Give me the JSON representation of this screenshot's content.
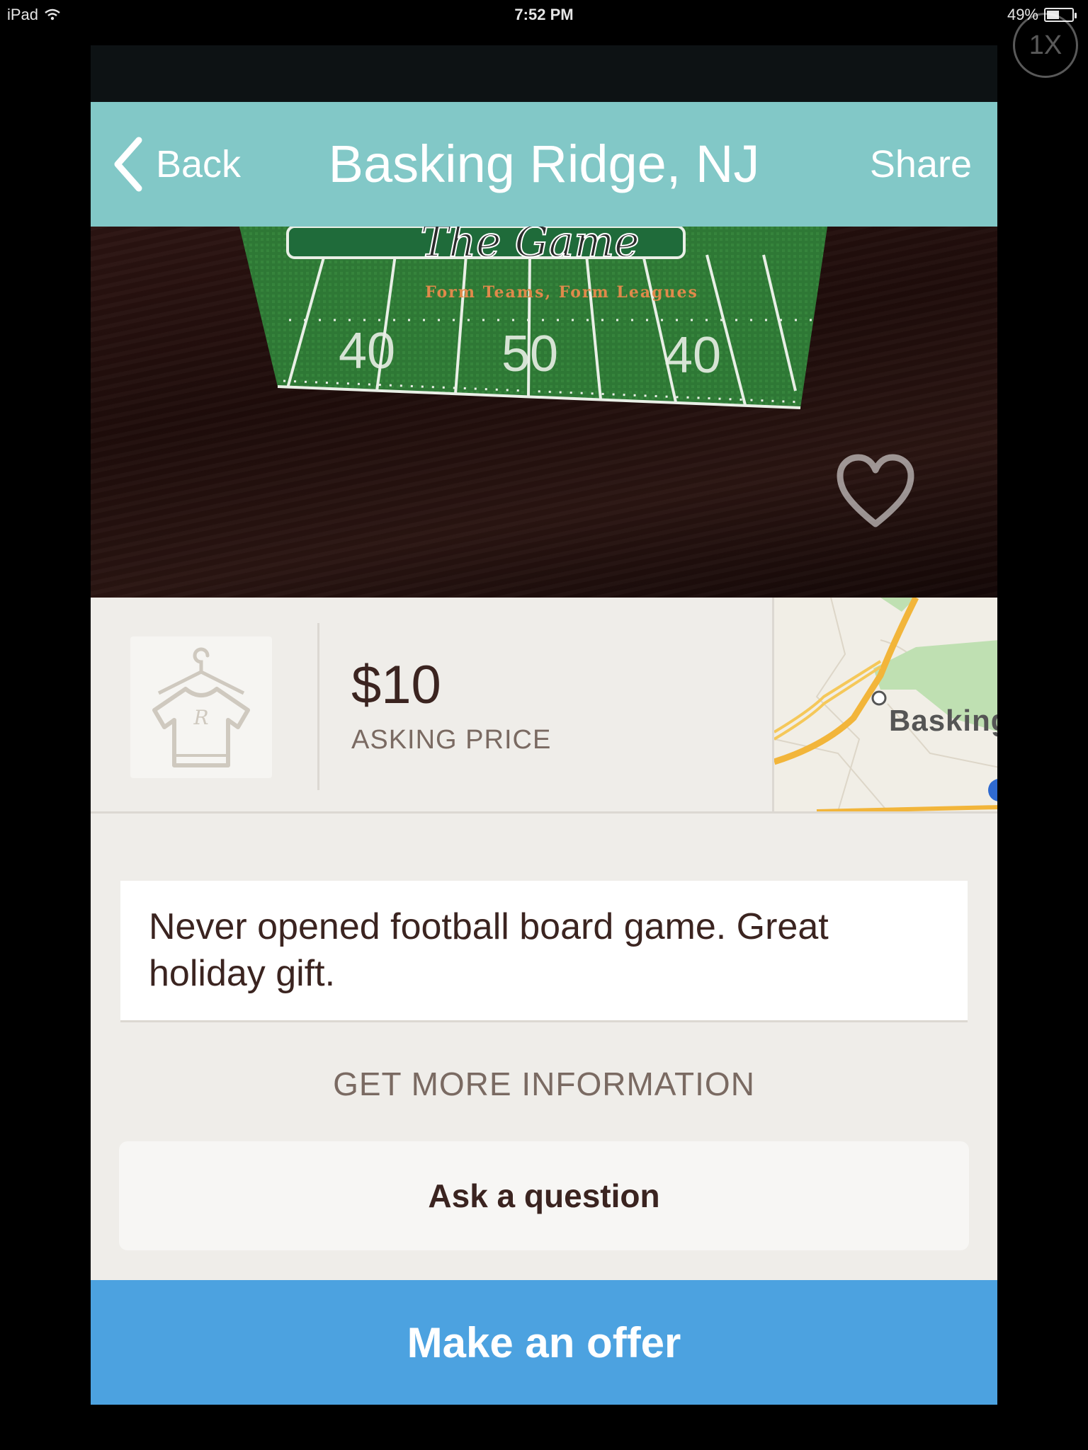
{
  "status_bar": {
    "device": "iPad",
    "time": "7:52 PM",
    "battery_text": "49%",
    "battery_level": 0.49,
    "zoom_badge": "1X"
  },
  "nav": {
    "back_label": "Back",
    "title": "Basking Ridge, NJ",
    "share_label": "Share"
  },
  "photo": {
    "box_title": "The Game",
    "box_subtitle": "Form Teams, Form Leagues",
    "yard_left": "40",
    "yard_center": "50",
    "yard_right": "40"
  },
  "listing": {
    "price": "$10",
    "price_label": "ASKING PRICE",
    "category_icon": "shirt-hanger-icon",
    "category_letter": "R",
    "map_label": "Basking"
  },
  "description": "Never opened football board game. Great holiday gift.",
  "actions": {
    "more_info_label": "GET MORE INFORMATION",
    "ask_label": "Ask a question",
    "offer_label": "Make an offer"
  },
  "colors": {
    "nav_bg": "#82c8c7",
    "offer_bg": "#4ca2e0",
    "text_dark": "#3b2420",
    "text_muted": "#7a6a62"
  }
}
